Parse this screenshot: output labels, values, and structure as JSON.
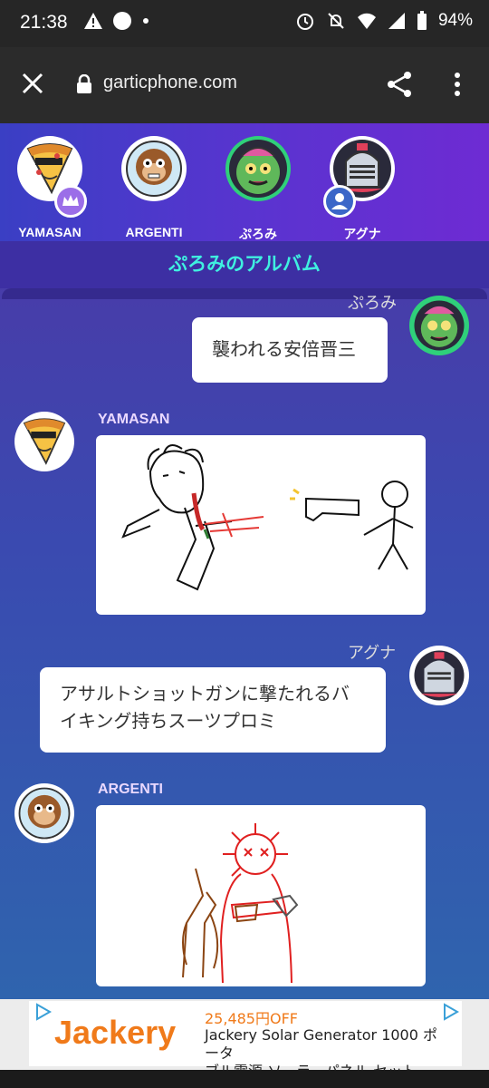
{
  "status_bar": {
    "time": "21:38",
    "battery": "94%"
  },
  "browser": {
    "url": "garticphone.com"
  },
  "players": [
    {
      "name": "YAMASAN",
      "badge": "crown"
    },
    {
      "name": "ARGENTI"
    },
    {
      "name": "ぷろみ"
    },
    {
      "name": "アグナ",
      "badge": "user"
    }
  ],
  "album": {
    "title": "ぷろみのアルバム",
    "entries": [
      {
        "author": "ぷろみ",
        "type": "text",
        "text": "襲われる安倍晋三"
      },
      {
        "author": "YAMASAN",
        "type": "drawing"
      },
      {
        "author": "アグナ",
        "type": "text",
        "text_line1": "アサルトショットガンに撃たれるバ",
        "text_line2": "イキング持ちスーツプロミ"
      },
      {
        "author": "ARGENTI",
        "type": "drawing"
      }
    ]
  },
  "ad": {
    "brand": "Jackery",
    "price": "25,485円OFF",
    "line1": "Jackery Solar Generator 1000 ポータ",
    "line2": "ブル電源 ソーラーパネル セット…"
  },
  "colors": {
    "accent_cyan": "#3ff0e0",
    "player_bar": "#5b33d0",
    "ad_orange": "#f07a1a"
  }
}
